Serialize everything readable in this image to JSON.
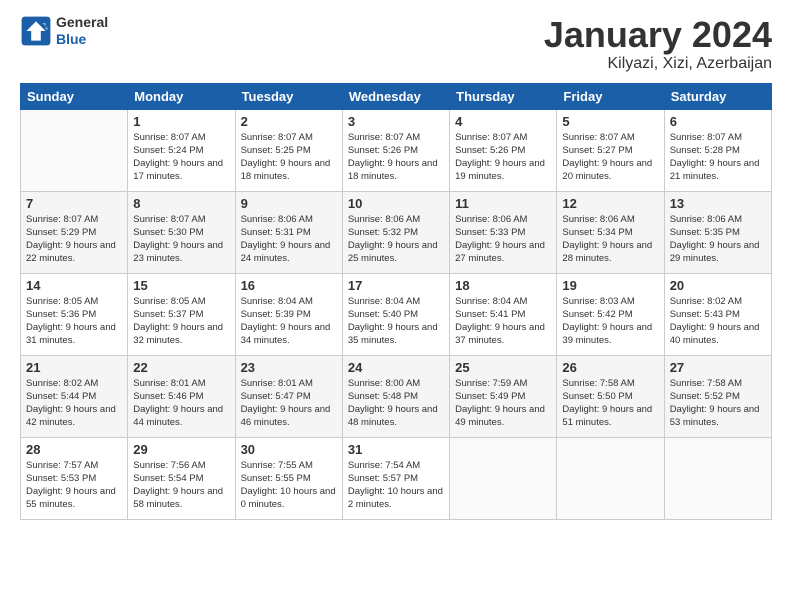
{
  "header": {
    "logo_general": "General",
    "logo_blue": "Blue",
    "month_title": "January 2024",
    "location": "Kilyazi, Xizi, Azerbaijan"
  },
  "days_of_week": [
    "Sunday",
    "Monday",
    "Tuesday",
    "Wednesday",
    "Thursday",
    "Friday",
    "Saturday"
  ],
  "weeks": [
    [
      {
        "day": "",
        "sunrise": "",
        "sunset": "",
        "daylight": ""
      },
      {
        "day": "1",
        "sunrise": "Sunrise: 8:07 AM",
        "sunset": "Sunset: 5:24 PM",
        "daylight": "Daylight: 9 hours and 17 minutes."
      },
      {
        "day": "2",
        "sunrise": "Sunrise: 8:07 AM",
        "sunset": "Sunset: 5:25 PM",
        "daylight": "Daylight: 9 hours and 18 minutes."
      },
      {
        "day": "3",
        "sunrise": "Sunrise: 8:07 AM",
        "sunset": "Sunset: 5:26 PM",
        "daylight": "Daylight: 9 hours and 18 minutes."
      },
      {
        "day": "4",
        "sunrise": "Sunrise: 8:07 AM",
        "sunset": "Sunset: 5:26 PM",
        "daylight": "Daylight: 9 hours and 19 minutes."
      },
      {
        "day": "5",
        "sunrise": "Sunrise: 8:07 AM",
        "sunset": "Sunset: 5:27 PM",
        "daylight": "Daylight: 9 hours and 20 minutes."
      },
      {
        "day": "6",
        "sunrise": "Sunrise: 8:07 AM",
        "sunset": "Sunset: 5:28 PM",
        "daylight": "Daylight: 9 hours and 21 minutes."
      }
    ],
    [
      {
        "day": "7",
        "sunrise": "Sunrise: 8:07 AM",
        "sunset": "Sunset: 5:29 PM",
        "daylight": "Daylight: 9 hours and 22 minutes."
      },
      {
        "day": "8",
        "sunrise": "Sunrise: 8:07 AM",
        "sunset": "Sunset: 5:30 PM",
        "daylight": "Daylight: 9 hours and 23 minutes."
      },
      {
        "day": "9",
        "sunrise": "Sunrise: 8:06 AM",
        "sunset": "Sunset: 5:31 PM",
        "daylight": "Daylight: 9 hours and 24 minutes."
      },
      {
        "day": "10",
        "sunrise": "Sunrise: 8:06 AM",
        "sunset": "Sunset: 5:32 PM",
        "daylight": "Daylight: 9 hours and 25 minutes."
      },
      {
        "day": "11",
        "sunrise": "Sunrise: 8:06 AM",
        "sunset": "Sunset: 5:33 PM",
        "daylight": "Daylight: 9 hours and 27 minutes."
      },
      {
        "day": "12",
        "sunrise": "Sunrise: 8:06 AM",
        "sunset": "Sunset: 5:34 PM",
        "daylight": "Daylight: 9 hours and 28 minutes."
      },
      {
        "day": "13",
        "sunrise": "Sunrise: 8:06 AM",
        "sunset": "Sunset: 5:35 PM",
        "daylight": "Daylight: 9 hours and 29 minutes."
      }
    ],
    [
      {
        "day": "14",
        "sunrise": "Sunrise: 8:05 AM",
        "sunset": "Sunset: 5:36 PM",
        "daylight": "Daylight: 9 hours and 31 minutes."
      },
      {
        "day": "15",
        "sunrise": "Sunrise: 8:05 AM",
        "sunset": "Sunset: 5:37 PM",
        "daylight": "Daylight: 9 hours and 32 minutes."
      },
      {
        "day": "16",
        "sunrise": "Sunrise: 8:04 AM",
        "sunset": "Sunset: 5:39 PM",
        "daylight": "Daylight: 9 hours and 34 minutes."
      },
      {
        "day": "17",
        "sunrise": "Sunrise: 8:04 AM",
        "sunset": "Sunset: 5:40 PM",
        "daylight": "Daylight: 9 hours and 35 minutes."
      },
      {
        "day": "18",
        "sunrise": "Sunrise: 8:04 AM",
        "sunset": "Sunset: 5:41 PM",
        "daylight": "Daylight: 9 hours and 37 minutes."
      },
      {
        "day": "19",
        "sunrise": "Sunrise: 8:03 AM",
        "sunset": "Sunset: 5:42 PM",
        "daylight": "Daylight: 9 hours and 39 minutes."
      },
      {
        "day": "20",
        "sunrise": "Sunrise: 8:02 AM",
        "sunset": "Sunset: 5:43 PM",
        "daylight": "Daylight: 9 hours and 40 minutes."
      }
    ],
    [
      {
        "day": "21",
        "sunrise": "Sunrise: 8:02 AM",
        "sunset": "Sunset: 5:44 PM",
        "daylight": "Daylight: 9 hours and 42 minutes."
      },
      {
        "day": "22",
        "sunrise": "Sunrise: 8:01 AM",
        "sunset": "Sunset: 5:46 PM",
        "daylight": "Daylight: 9 hours and 44 minutes."
      },
      {
        "day": "23",
        "sunrise": "Sunrise: 8:01 AM",
        "sunset": "Sunset: 5:47 PM",
        "daylight": "Daylight: 9 hours and 46 minutes."
      },
      {
        "day": "24",
        "sunrise": "Sunrise: 8:00 AM",
        "sunset": "Sunset: 5:48 PM",
        "daylight": "Daylight: 9 hours and 48 minutes."
      },
      {
        "day": "25",
        "sunrise": "Sunrise: 7:59 AM",
        "sunset": "Sunset: 5:49 PM",
        "daylight": "Daylight: 9 hours and 49 minutes."
      },
      {
        "day": "26",
        "sunrise": "Sunrise: 7:58 AM",
        "sunset": "Sunset: 5:50 PM",
        "daylight": "Daylight: 9 hours and 51 minutes."
      },
      {
        "day": "27",
        "sunrise": "Sunrise: 7:58 AM",
        "sunset": "Sunset: 5:52 PM",
        "daylight": "Daylight: 9 hours and 53 minutes."
      }
    ],
    [
      {
        "day": "28",
        "sunrise": "Sunrise: 7:57 AM",
        "sunset": "Sunset: 5:53 PM",
        "daylight": "Daylight: 9 hours and 55 minutes."
      },
      {
        "day": "29",
        "sunrise": "Sunrise: 7:56 AM",
        "sunset": "Sunset: 5:54 PM",
        "daylight": "Daylight: 9 hours and 58 minutes."
      },
      {
        "day": "30",
        "sunrise": "Sunrise: 7:55 AM",
        "sunset": "Sunset: 5:55 PM",
        "daylight": "Daylight: 10 hours and 0 minutes."
      },
      {
        "day": "31",
        "sunrise": "Sunrise: 7:54 AM",
        "sunset": "Sunset: 5:57 PM",
        "daylight": "Daylight: 10 hours and 2 minutes."
      },
      {
        "day": "",
        "sunrise": "",
        "sunset": "",
        "daylight": ""
      },
      {
        "day": "",
        "sunrise": "",
        "sunset": "",
        "daylight": ""
      },
      {
        "day": "",
        "sunrise": "",
        "sunset": "",
        "daylight": ""
      }
    ]
  ]
}
